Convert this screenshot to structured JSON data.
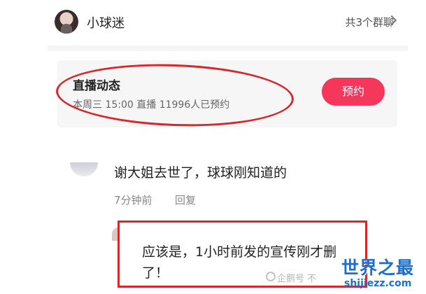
{
  "header": {
    "username": "小球迷",
    "group_link": "共3个群聊"
  },
  "live": {
    "title": "直播动态",
    "subtitle": "本周三 15:00 直播 11996人已预约",
    "button": "预约"
  },
  "comment": {
    "text": "谢大姐去世了，球球刚知道的",
    "time": "7分钟前",
    "reply_label": "回复"
  },
  "reply": {
    "text": "应该是，1小时前发的宣传刚才删了！"
  },
  "watermark": {
    "small": "企鹅号 不",
    "big": "世界之最",
    "domain": "shijiezz.com"
  },
  "colors": {
    "accent": "#f5375c",
    "annotation_red": "#d9262b",
    "watermark_blue": "#1a6fd2"
  }
}
